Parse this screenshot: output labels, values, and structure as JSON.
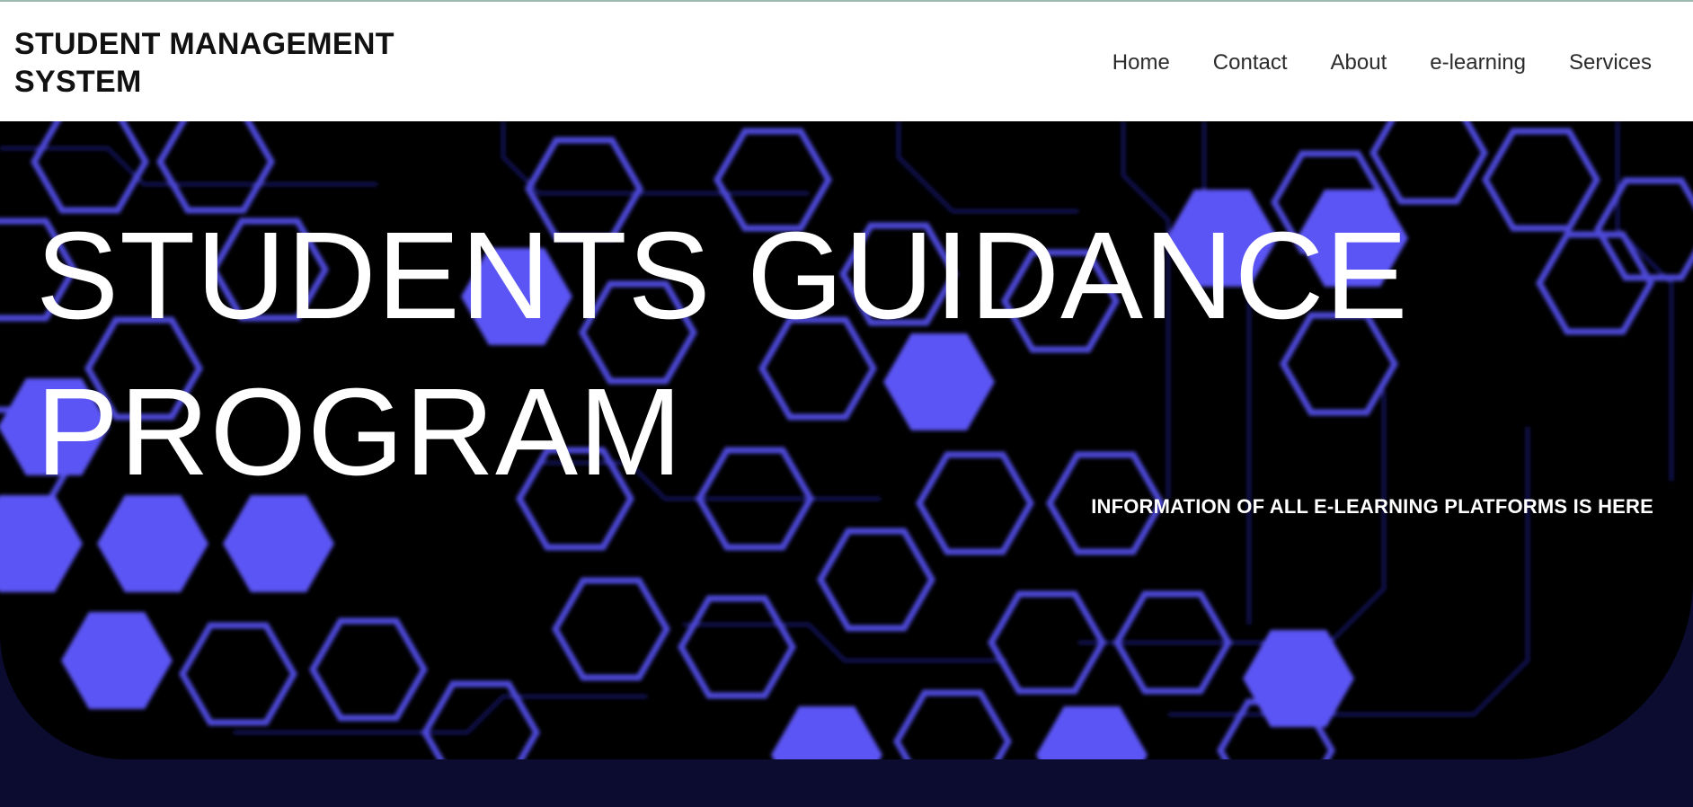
{
  "header": {
    "brand_line1": "STUDENT MANAGEMENT",
    "brand_line2": "SYSTEM"
  },
  "nav": {
    "items": [
      {
        "label": "Home"
      },
      {
        "label": "Contact"
      },
      {
        "label": "About"
      },
      {
        "label": "e-learning"
      },
      {
        "label": "Services"
      }
    ]
  },
  "hero": {
    "title_line1": "STUDENTS GUIDANCE",
    "title_line2": "PROGRAM",
    "tagline": "INFORMATION OF ALL E-LEARNING PLATFORMS IS HERE"
  },
  "colors": {
    "header_bg": "#ffffff",
    "hero_bg": "#000000",
    "hex_accent": "#5b55f5",
    "page_bottom": "#0b0c30",
    "text_on_hero": "#ffffff"
  }
}
